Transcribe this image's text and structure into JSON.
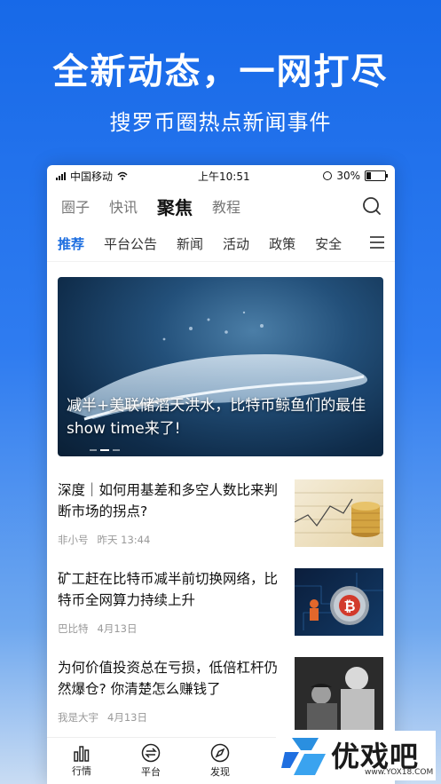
{
  "promo": {
    "title": "全新动态，一网打尽",
    "subtitle": "搜罗币圈热点新闻事件"
  },
  "status_bar": {
    "carrier": "中国移动",
    "time": "上午10:51",
    "battery": "30%",
    "battery_level": 0.3
  },
  "top_tabs": [
    {
      "label": "圈子",
      "active": false
    },
    {
      "label": "快讯",
      "active": false
    },
    {
      "label": "聚焦",
      "active": true
    },
    {
      "label": "教程",
      "active": false
    }
  ],
  "sub_tabs": [
    {
      "label": "推荐",
      "active": true
    },
    {
      "label": "平台公告",
      "active": false
    },
    {
      "label": "新闻",
      "active": false
    },
    {
      "label": "活动",
      "active": false
    },
    {
      "label": "政策",
      "active": false
    },
    {
      "label": "安全",
      "active": false
    }
  ],
  "banner": {
    "title": "减半+美联储滔天洪水，比特币鲸鱼们的最佳show time来了!"
  },
  "articles": [
    {
      "title": "深度｜如何用基差和多空人数比来判断市场的拐点?",
      "author": "非小号",
      "time": "昨天 13:44",
      "thumb": "coins-chart"
    },
    {
      "title": "矿工赶在比特币减半前切换网络，比特币全网算力持续上升",
      "author": "巴比特",
      "time": "4月13日",
      "thumb": "bitcoin-miner"
    },
    {
      "title": "为何价值投资总在亏损，低倍杠杆仍然爆仓? 你清楚怎么赚钱了",
      "author": "我是大宇",
      "time": "4月13日",
      "thumb": "vintage-photo"
    }
  ],
  "bottom_nav": [
    {
      "label": "行情",
      "icon": "bar-chart-icon"
    },
    {
      "label": "平台",
      "icon": "exchange-icon"
    },
    {
      "label": "发现",
      "icon": "compass-icon"
    }
  ],
  "watermark": {
    "text": "优戏吧",
    "url": "www.YOX18.COM"
  },
  "colors": {
    "accent": "#1f6fe0",
    "background_top": "#1769e8"
  }
}
